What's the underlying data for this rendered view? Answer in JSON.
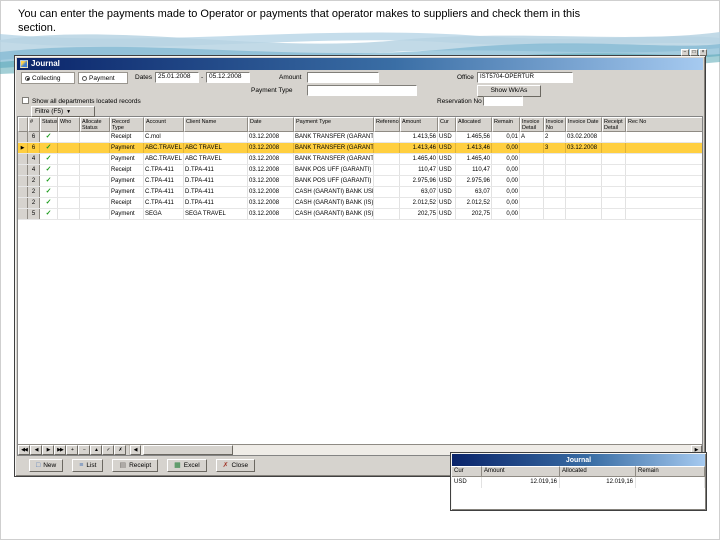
{
  "caption": {
    "text": "You can enter the payments made to Operator or payments that operator makes to suppliers and check them in this section."
  },
  "colors": {
    "highlight_row": "#ffcf40",
    "titlebar_start": "#0a246a",
    "titlebar_end": "#a6caf0",
    "check_green": "#1f9d1f"
  },
  "app_controls": [
    {
      "name": "minimize-button",
      "glyph": "−"
    },
    {
      "name": "restore-button",
      "glyph": "□"
    },
    {
      "name": "close-button",
      "glyph": "×"
    }
  ],
  "journal_window": {
    "title": "Journal",
    "form": {
      "mode_options": [
        "Collecting",
        "Payment"
      ],
      "selected_mode": "Collecting",
      "dates_label": "Dates",
      "date_from": "25.01.2008",
      "date_separator": "-",
      "date_to": "05.12.2008",
      "amount_label": "Amount",
      "amount_value": "",
      "office_label": "Office",
      "office_value": "IST5704-OPERTUR",
      "show_wkas_button": "Show Wk/As",
      "payment_type_label": "Payment Type",
      "payment_type_value": "",
      "reservation_label": "Reservation No",
      "reservation_value": "",
      "show_all_label": "Show all departments located records",
      "filter_button": "Filtre (F5)"
    },
    "grid": {
      "columns": [
        "#",
        "Status",
        "Who",
        "Allocate Status",
        "Record Type",
        "Account",
        "Client Name",
        "Date",
        "Payment Type",
        "Reference",
        "Amount",
        "Cur",
        "Allocated",
        "Remain",
        "Invoice Detail",
        "Invoice No",
        "Invoice Date",
        "Receipt Detail",
        "Rec No"
      ],
      "rows": [
        {
          "num": "6",
          "status": "✓",
          "who": "",
          "alloc_status": "",
          "record_type": "Receipt",
          "account": "C.mol",
          "client": "",
          "date": "03.12.2008",
          "payment_type": "BANK TRANSFER (GARANTI)",
          "reference": "",
          "amount": "1.413,56",
          "cur": "USD",
          "allocated": "1.465,56",
          "remain": "0,01",
          "inv_detail": "A",
          "inv_no": "2",
          "inv_date": "03.02.2008",
          "rec_detail": "",
          "rec_no": "",
          "highlighted": false
        },
        {
          "num": "6",
          "status": "✓",
          "who": "",
          "alloc_status": "",
          "record_type": "Payment",
          "account": "ABC.TRAVEL",
          "client": "ABC TRAVEL",
          "date": "03.12.2008",
          "payment_type": "BANK TRANSFER (GARANTI)",
          "reference": "",
          "amount": "1.413,46",
          "cur": "USD",
          "allocated": "1.413,46",
          "remain": "0,00",
          "inv_detail": "",
          "inv_no": "3",
          "inv_date": "03.12.2008",
          "rec_detail": "",
          "rec_no": "",
          "highlighted": true
        },
        {
          "num": "4",
          "status": "✓",
          "who": "",
          "alloc_status": "",
          "record_type": "Payment",
          "account": "ABC.TRAVEL",
          "client": "ABC TRAVEL",
          "date": "03.12.2008",
          "payment_type": "BANK TRANSFER (GARANTI)",
          "reference": "",
          "amount": "1.465,40",
          "cur": "USD",
          "allocated": "1.465,40",
          "remain": "0,00",
          "inv_detail": "",
          "inv_no": "",
          "inv_date": "",
          "rec_detail": "",
          "rec_no": "",
          "highlighted": false
        },
        {
          "num": "4",
          "status": "✓",
          "who": "",
          "alloc_status": "",
          "record_type": "Receipt",
          "account": "C.TPA-411",
          "client": "D.TPA-411",
          "date": "03.12.2008",
          "payment_type": "BANK POS UFF (GARANTI)",
          "reference": "",
          "amount": "110,47",
          "cur": "USD",
          "allocated": "110,47",
          "remain": "0,00",
          "inv_detail": "",
          "inv_no": "",
          "inv_date": "",
          "rec_detail": "",
          "rec_no": "",
          "highlighted": false
        },
        {
          "num": "2",
          "status": "✓",
          "who": "",
          "alloc_status": "",
          "record_type": "Payment",
          "account": "C.TPA-411",
          "client": "D.TPA-411",
          "date": "03.12.2008",
          "payment_type": "BANK POS UFF (GARANTI)",
          "reference": "",
          "amount": "2.975,96",
          "cur": "USD",
          "allocated": "2.975,96",
          "remain": "0,00",
          "inv_detail": "",
          "inv_no": "",
          "inv_date": "",
          "rec_detail": "",
          "rec_no": "",
          "highlighted": false
        },
        {
          "num": "2",
          "status": "✓",
          "who": "",
          "alloc_status": "",
          "record_type": "Payment",
          "account": "C.TPA-411",
          "client": "D.TPA-411",
          "date": "03.12.2008",
          "payment_type": "CASH (GARANTI) BANK USD",
          "reference": "",
          "amount": "63,07",
          "cur": "USD",
          "allocated": "63,07",
          "remain": "0,00",
          "inv_detail": "",
          "inv_no": "",
          "inv_date": "",
          "rec_detail": "",
          "rec_no": "",
          "highlighted": false
        },
        {
          "num": "2",
          "status": "✓",
          "who": "",
          "alloc_status": "",
          "record_type": "Receipt",
          "account": "C.TPA-411",
          "client": "D.TPA-411",
          "date": "03.12.2008",
          "payment_type": "CASH (GARANTI) BANK (IS)",
          "reference": "",
          "amount": "2.012,52",
          "cur": "USD",
          "allocated": "2.012,52",
          "remain": "0,00",
          "inv_detail": "",
          "inv_no": "",
          "inv_date": "",
          "rec_detail": "",
          "rec_no": "",
          "highlighted": false
        },
        {
          "num": "5",
          "status": "✓",
          "who": "",
          "alloc_status": "",
          "record_type": "Payment",
          "account": "SEGA",
          "client": "SEGA TRAVEL",
          "date": "03.12.2008",
          "payment_type": "CASH (GARANTI) BANK (IS)",
          "reference": "",
          "amount": "202,75",
          "cur": "USD",
          "allocated": "202,75",
          "remain": "0,00",
          "inv_detail": "",
          "inv_no": "",
          "inv_date": "",
          "rec_detail": "",
          "rec_no": "",
          "highlighted": false
        }
      ]
    },
    "navigator": [
      {
        "name": "nav-first-button",
        "glyph": "◀◀"
      },
      {
        "name": "nav-prior-button",
        "glyph": "◀"
      },
      {
        "name": "nav-next-button",
        "glyph": "▶"
      },
      {
        "name": "nav-last-button",
        "glyph": "▶▶"
      },
      {
        "name": "nav-insert-button",
        "glyph": "+"
      },
      {
        "name": "nav-delete-button",
        "glyph": "−"
      },
      {
        "name": "nav-edit-button",
        "glyph": "▲"
      },
      {
        "name": "nav-post-button",
        "glyph": "✓"
      },
      {
        "name": "nav-cancel-button",
        "glyph": "✗"
      }
    ]
  },
  "toolbar": {
    "buttons": [
      {
        "label": "New",
        "icon": "new-page-icon",
        "glyph": "□"
      },
      {
        "label": "List",
        "icon": "list-icon",
        "glyph": "≡"
      },
      {
        "label": "Receipt",
        "icon": "receipt-icon",
        "glyph": "▤"
      },
      {
        "label": "Excel",
        "icon": "excel-icon",
        "glyph": "▦"
      },
      {
        "label": "Close",
        "icon": "close-door-icon",
        "glyph": "✗"
      }
    ]
  },
  "totals_window": {
    "title": "Journal",
    "columns": [
      "Cur",
      "Amount",
      "Allocated",
      "Remain"
    ],
    "rows": [
      {
        "cur": "USD",
        "amount": "12.019,16",
        "allocated": "12.019,16",
        "remain": ""
      }
    ]
  }
}
